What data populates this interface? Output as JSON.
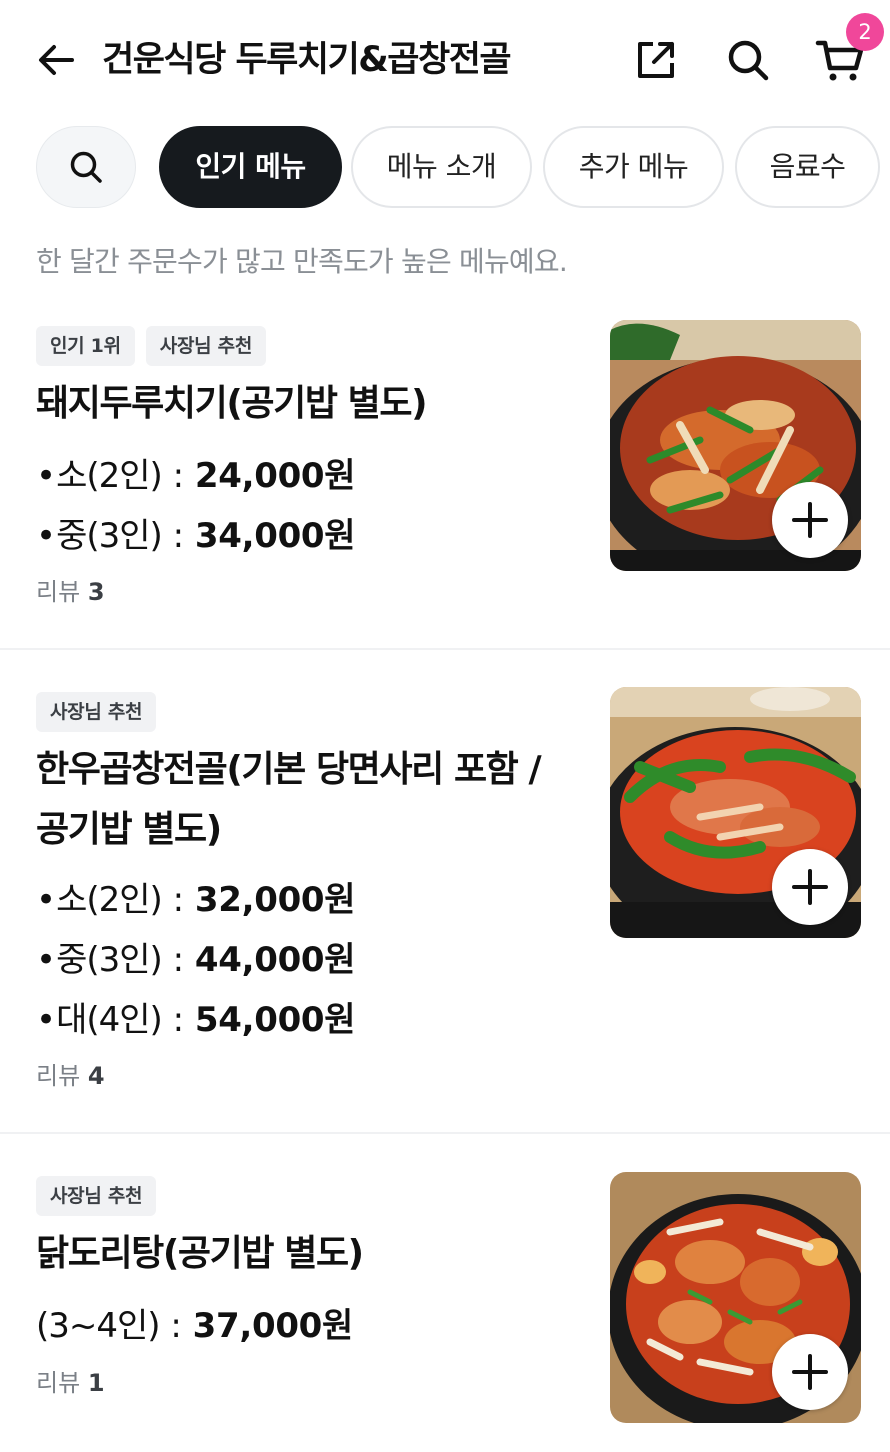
{
  "header": {
    "title": "건운식당 두루치기&곱창전골",
    "cart_count": "2",
    "badge_color": "#f0479a"
  },
  "tabs": [
    {
      "label": "인기 메뉴",
      "active": true
    },
    {
      "label": "메뉴 소개",
      "active": false
    },
    {
      "label": "추가 메뉴",
      "active": false
    },
    {
      "label": "음료수",
      "active": false
    }
  ],
  "subtitle": "한 달간 주문수가 많고 만족도가 높은 메뉴예요.",
  "menu_items": [
    {
      "badges": [
        "인기 1위",
        "사장님 추천"
      ],
      "name": "돼지두루치기(공기밥 별도)",
      "prices": [
        {
          "option": "소(2인)",
          "amount": "24,000원"
        },
        {
          "option": "중(3인)",
          "amount": "34,000원"
        }
      ],
      "review_label": "리뷰",
      "review_count": "3",
      "image_icon": "spicy-pork-stew-photo"
    },
    {
      "badges": [
        "사장님 추천"
      ],
      "name": "한우곱창전골(기본 당면사리 포함 / 공기밥 별도)",
      "prices": [
        {
          "option": "소(2인)",
          "amount": "32,000원"
        },
        {
          "option": "중(3인)",
          "amount": "44,000원"
        },
        {
          "option": "대(4인)",
          "amount": "54,000원"
        }
      ],
      "review_label": "리뷰",
      "review_count": "4",
      "image_icon": "beef-tripe-hotpot-photo"
    },
    {
      "badges": [
        "사장님 추천"
      ],
      "name": "닭도리탕(공기밥 별도)",
      "prices": [
        {
          "option": "(3~4인)",
          "amount": "37,000원"
        }
      ],
      "review_label": "리뷰",
      "review_count": "1",
      "image_icon": "braised-chicken-photo"
    }
  ]
}
